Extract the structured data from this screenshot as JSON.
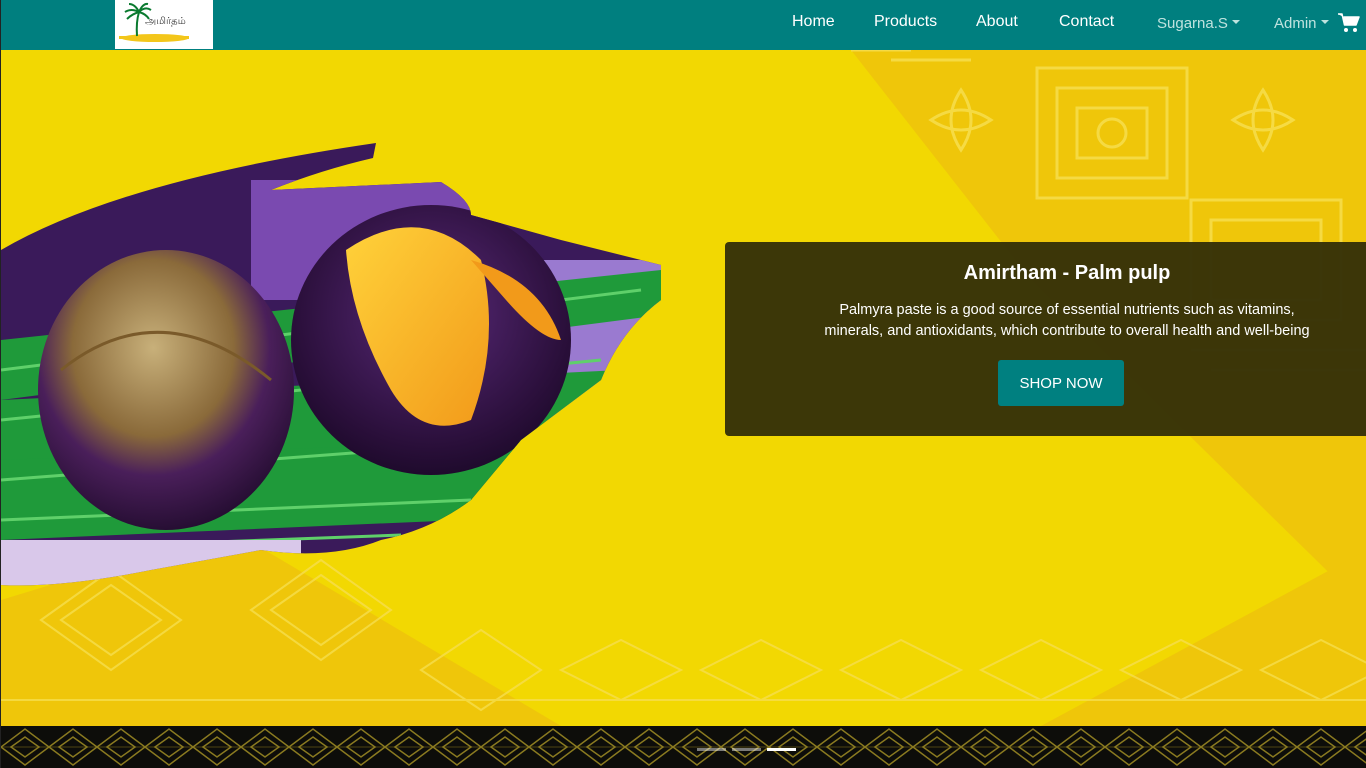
{
  "navbar": {
    "logo_alt": "அமிர்தம்",
    "links": [
      {
        "label": "Home"
      },
      {
        "label": "Products"
      },
      {
        "label": "About"
      },
      {
        "label": "Contact"
      }
    ],
    "user_menu": "Sugarna.S",
    "admin_menu": "Admin",
    "cart_icon": "shopping-cart-icon",
    "background_color": "#007f7f"
  },
  "hero": {
    "background_color": "#f2d802",
    "caption": {
      "title": "Amirtham - Palm pulp",
      "description": "Palmyra paste is a good source of essential nutrients such as vitamins, minerals, and antioxidants, which contribute to overall health and well-being",
      "button_label": "SHOP NOW"
    },
    "carousel": {
      "slide_count": 3,
      "active_index": 2
    }
  }
}
